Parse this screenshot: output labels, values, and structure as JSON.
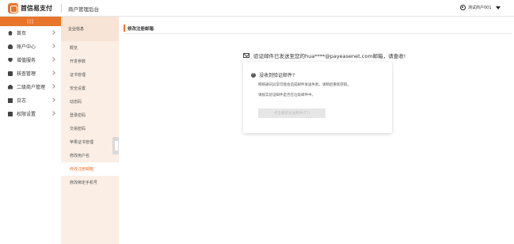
{
  "header": {
    "brand": "首信易支付",
    "system_name": "商户管理后台",
    "user_name": "测试商户001"
  },
  "sidebar": {
    "toggle_label": "|||",
    "items": [
      {
        "label": "首页",
        "icon": "home-icon"
      },
      {
        "label": "账户中心",
        "icon": "user-icon"
      },
      {
        "label": "增值服务",
        "icon": "shield-icon"
      },
      {
        "label": "核查管理",
        "icon": "document-icon"
      },
      {
        "label": "二级商户管理",
        "icon": "merchant-icon"
      },
      {
        "label": "日志",
        "icon": "log-icon"
      },
      {
        "label": "权限设置",
        "icon": "lock-icon"
      }
    ]
  },
  "subnav": {
    "header": "企业信息",
    "items": [
      {
        "label": "概览"
      },
      {
        "label": "开发参数"
      },
      {
        "label": "证书管理"
      },
      {
        "label": "安全设置"
      },
      {
        "label": "动态码"
      },
      {
        "label": "登录密码"
      },
      {
        "label": "交易密码"
      },
      {
        "label": "苹果证书管理"
      },
      {
        "label": "修改用户名"
      },
      {
        "label": "修改注册邮箱"
      },
      {
        "label": "修改绑定手机号"
      }
    ],
    "active_index": 9
  },
  "main": {
    "page_title": "修改注册邮箱",
    "notice": "验证邮件已发送至您的hua****@payeasenet.com邮箱，请查收!",
    "card": {
      "title": "没收到验证邮件?",
      "line1": "网络通讯异常可能会造成邮件发送失败，请稍后重新获取。",
      "line2": "请核实验证邮件是否在垃圾邮件中。",
      "button": "点击重新发送邮件(57)"
    }
  },
  "colors": {
    "accent": "#e8752a",
    "subnav_bg": "#fbeee4"
  }
}
